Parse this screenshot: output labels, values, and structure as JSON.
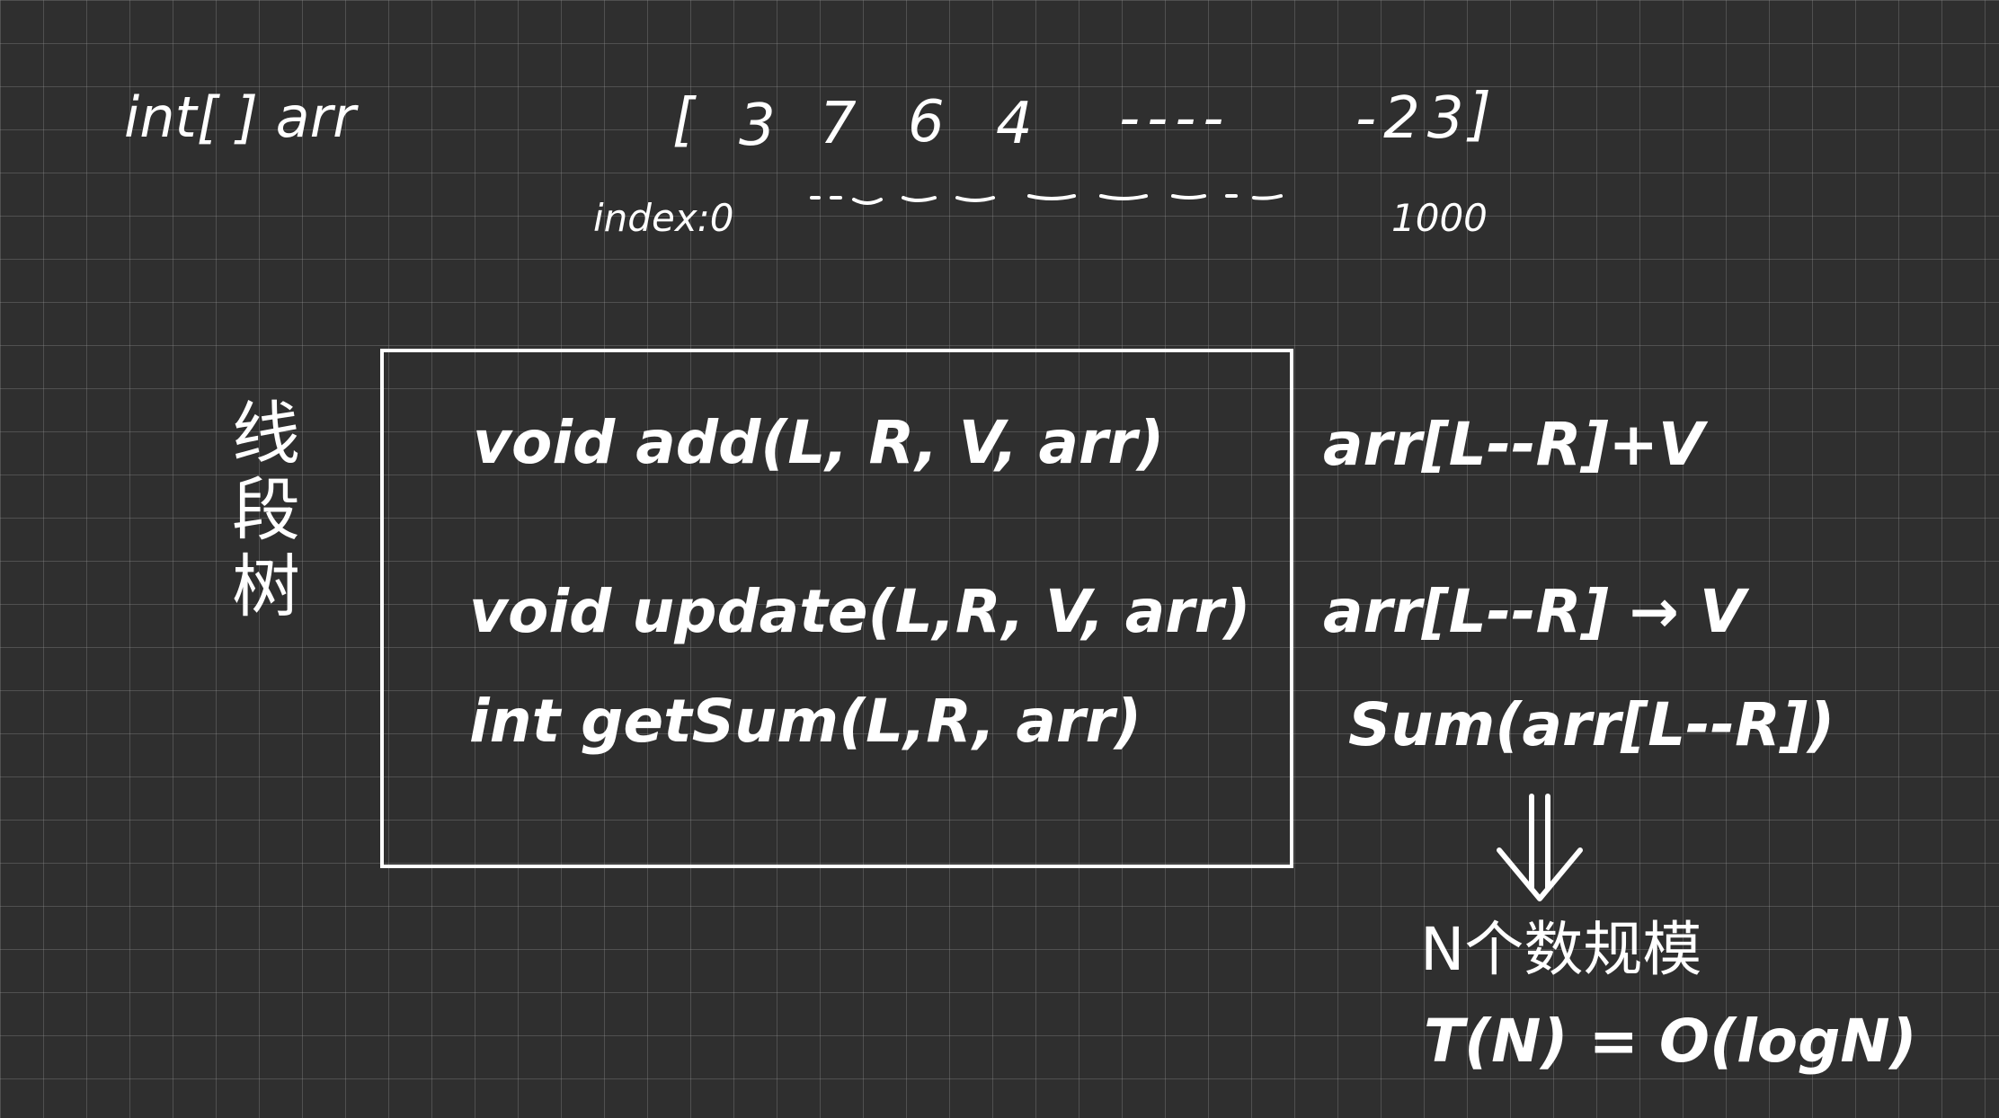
{
  "array": {
    "declaration": "int[ ] arr",
    "open_bracket": "[",
    "values": [
      "3",
      "7",
      "6",
      "4"
    ],
    "ellipsis": "----",
    "last_value": "-23",
    "close_bracket": "]"
  },
  "index": {
    "label": "index:0",
    "end": "1000"
  },
  "label": {
    "chars": [
      "线",
      "段",
      "树"
    ]
  },
  "api": {
    "add": {
      "signature": "void  add(L, R, V, arr)",
      "meaning": "arr[L--R]+V"
    },
    "update": {
      "signature": "void  update(L,R, V, arr)",
      "meaning": "arr[L--R] → V"
    },
    "getsum": {
      "signature": "int  getSum(L,R, arr)",
      "meaning": "Sum(arr[L--R])"
    }
  },
  "complexity": {
    "scale": "N个数规模",
    "formula": "T(N) = O(logN)"
  }
}
